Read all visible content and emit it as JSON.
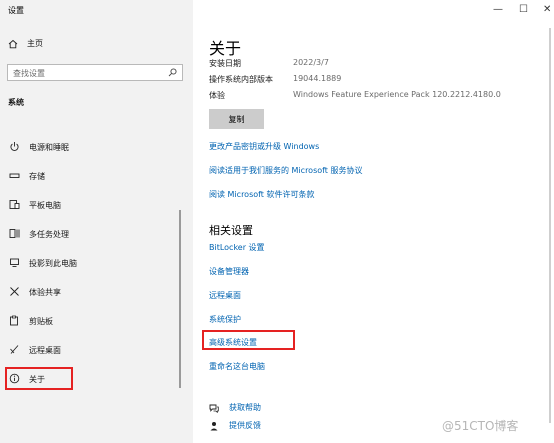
{
  "window": {
    "title": "设置",
    "controls": {
      "minimize": "—",
      "maximize": "☐",
      "close": "✕"
    }
  },
  "sidebar": {
    "home_label": "主页",
    "search_placeholder": "查找设置",
    "section_title": "系统",
    "items": [
      {
        "label": "电源和睡眠",
        "icon": "power-icon"
      },
      {
        "label": "存储",
        "icon": "storage-icon"
      },
      {
        "label": "平板电脑",
        "icon": "tablet-icon"
      },
      {
        "label": "多任务处理",
        "icon": "multitasking-icon"
      },
      {
        "label": "投影到此电脑",
        "icon": "projecting-icon"
      },
      {
        "label": "体验共享",
        "icon": "shared-experiences-icon"
      },
      {
        "label": "剪贴板",
        "icon": "clipboard-icon"
      },
      {
        "label": "远程桌面",
        "icon": "remote-desktop-icon"
      },
      {
        "label": "关于",
        "icon": "info-icon",
        "selected": true
      }
    ]
  },
  "main": {
    "title": "关于",
    "specs": [
      {
        "key": "安装日期",
        "value": "2022/3/7"
      },
      {
        "key": "操作系统内部版本",
        "value": "19044.1889"
      },
      {
        "key": "体验",
        "value": "Windows Feature Experience Pack 120.2212.4180.0"
      }
    ],
    "copy_button": "复制",
    "links": [
      "更改产品密钥或升级 Windows",
      "阅读适用于我们服务的 Microsoft 服务协议",
      "阅读 Microsoft 软件许可条款"
    ],
    "related_title": "相关设置",
    "related_links": [
      "BitLocker 设置",
      "设备管理器",
      "远程桌面",
      "系统保护",
      "高级系统设置",
      "重命名这台电脑"
    ],
    "help": {
      "get_help": "获取帮助",
      "feedback": "提供反馈"
    }
  },
  "watermark": "@51CTO博客",
  "colors": {
    "link": "#0063b1",
    "highlight": "#e52222",
    "sidebar_bg": "#f2f2f2"
  }
}
